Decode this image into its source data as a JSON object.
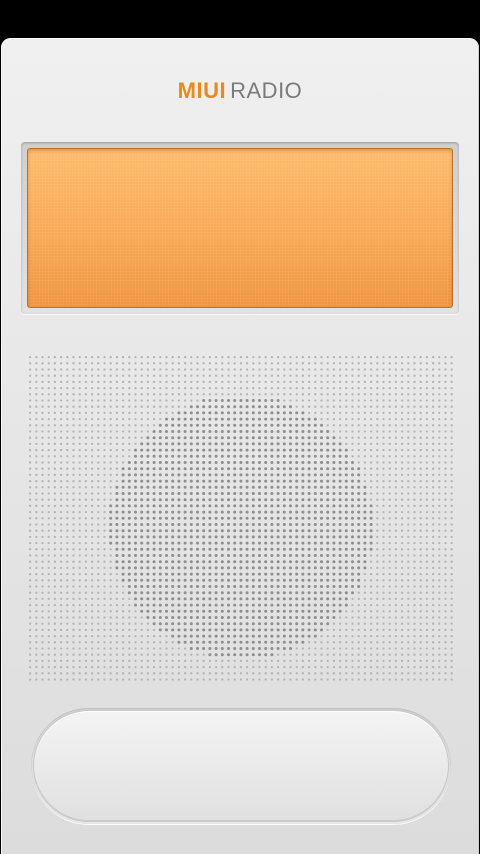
{
  "app": {
    "brand_primary": "MIUI",
    "brand_secondary": "RADIO"
  },
  "display": {
    "frequency_text": ""
  },
  "colors": {
    "accent": "#e98a1c",
    "display_orange": "#f9a955",
    "body": "#e6e6e6"
  },
  "icons": {
    "speaker": "speaker-grille-icon"
  }
}
